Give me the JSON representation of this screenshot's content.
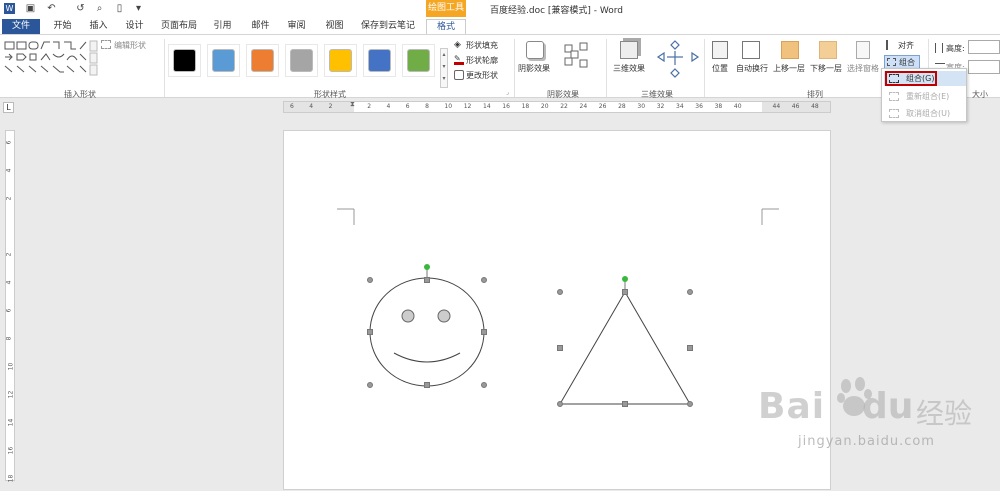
{
  "window": {
    "title": "百度经验.doc [兼容模式] - Word",
    "context_tab": "绘图工具"
  },
  "tabs": {
    "file": "文件",
    "items": [
      "开始",
      "插入",
      "设计",
      "页面布局",
      "引用",
      "邮件",
      "审阅",
      "视图",
      "保存到云笔记",
      "格式"
    ],
    "active": "格式"
  },
  "ribbon": {
    "insert_shapes": {
      "label": "插入形状",
      "edit_shape": "编辑形状"
    },
    "shape_styles": {
      "label": "形状样式",
      "swatches": [
        "#000000",
        "#5b9bd5",
        "#ed7d31",
        "#a5a5a5",
        "#ffc000",
        "#4472c4",
        "#70ad47"
      ],
      "fill": "形状填充",
      "outline": "形状轮廓",
      "change": "更改形状"
    },
    "shadow": {
      "button": "阴影效果",
      "label": "阴影效果"
    },
    "threed": {
      "button": "三维效果",
      "label": "三维效果"
    },
    "arrange": {
      "label": "排列",
      "position": "位置",
      "wrap": "自动换行",
      "forward": "上移一层",
      "backward": "下移一层",
      "selection": "选择窗格",
      "align": "对齐",
      "group": "组合"
    },
    "size": {
      "height": "高度:",
      "width": "宽度:",
      "label": "大小"
    }
  },
  "dropdown": {
    "items": [
      {
        "label": "组合(G)",
        "enabled": true,
        "highlighted": true
      },
      {
        "label": "重新组合(E)",
        "enabled": false
      },
      {
        "label": "取消组合(U)",
        "enabled": false
      }
    ]
  },
  "ruler": {
    "h_ticks": [
      "6",
      "4",
      "2",
      "",
      "2",
      "4",
      "6",
      "8",
      "10",
      "12",
      "14",
      "16",
      "18",
      "20",
      "22",
      "24",
      "26",
      "28",
      "30",
      "32",
      "34",
      "36",
      "38",
      "40",
      "",
      "44",
      "46",
      "48"
    ],
    "v_ticks": [
      "6",
      "4",
      "2",
      "",
      "2",
      "4",
      "6",
      "8",
      "10",
      "12",
      "14",
      "16",
      "18"
    ]
  },
  "watermark": {
    "brand": "Bai",
    "suffix": "经验",
    "url": "jingyan.baidu.com"
  },
  "colors": {
    "accent": "#2b579a",
    "context_tab": "#f5a623",
    "highlight": "#c00000",
    "rotate_handle": "#3bb83b"
  }
}
